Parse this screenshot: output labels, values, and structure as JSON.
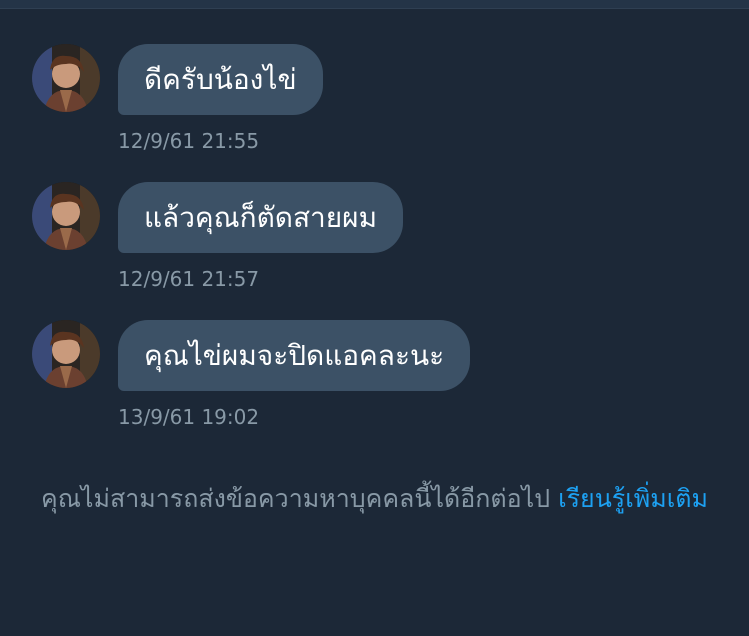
{
  "colors": {
    "background": "#1c2837",
    "bubble": "#3c5166",
    "bubble_text": "#ffffff",
    "timestamp_text": "#8899a6",
    "link": "#1da1f2"
  },
  "messages": [
    {
      "text": "ดีครับน้องไข่",
      "time": "12/9/61 21:55"
    },
    {
      "text": "แล้วคุณก็ตัดสายผม",
      "time": "12/9/61 21:57"
    },
    {
      "text": "คุณไข่ผมจะปิดแอคละนะ",
      "time": "13/9/61 19:02"
    }
  ],
  "notice": {
    "text": "คุณไม่สามารถส่งข้อความหาบุคคลนี้ได้อีกต่อไป",
    "link_label": "เรียนรู้เพิ่มเติม"
  },
  "icons": {
    "avatar": "profile-photo-avatar"
  }
}
